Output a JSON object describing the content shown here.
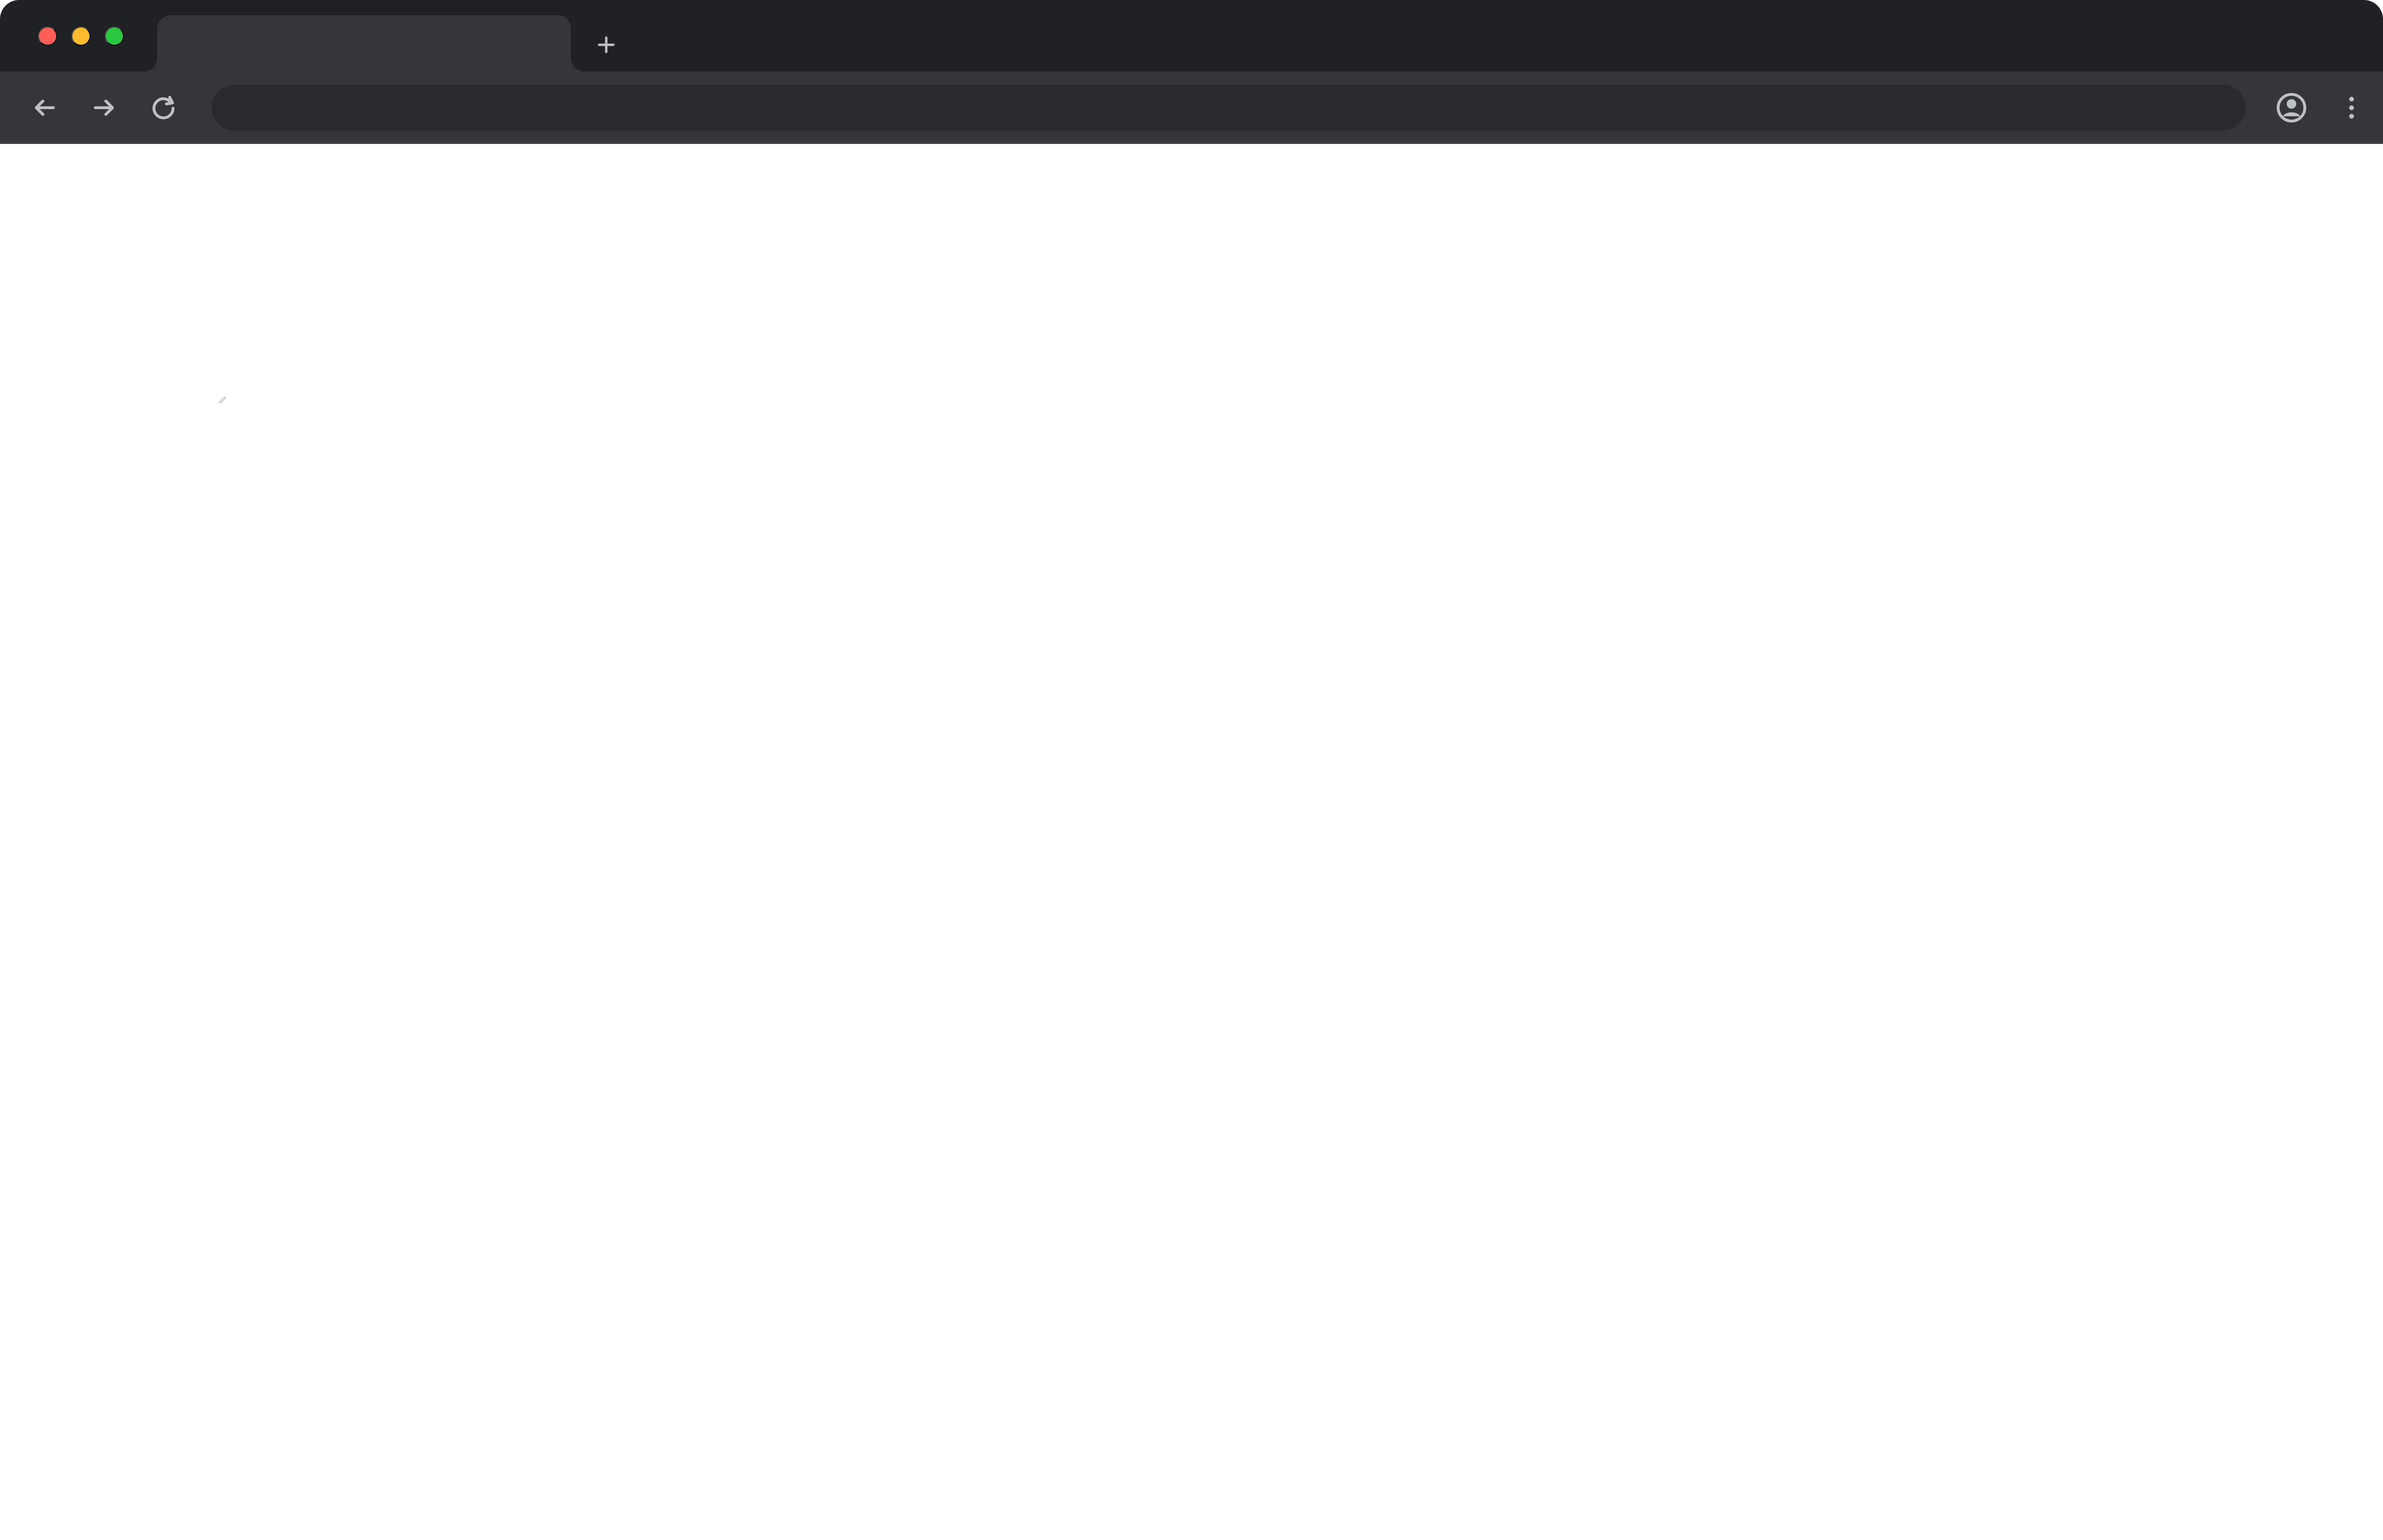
{
  "browser": {
    "tab": {
      "title": ""
    },
    "address_bar": {
      "value": "",
      "placeholder": ""
    },
    "content": {
      "visible_text": ""
    }
  },
  "icons": {
    "window_controls": [
      "close-icon",
      "minimize-icon",
      "maximize-icon"
    ],
    "new_tab": "plus-icon",
    "back": "arrow-left-icon",
    "forward": "arrow-right-icon",
    "reload": "reload-icon",
    "profile": "profile-icon",
    "menu": "vertical-dots-icon"
  },
  "colors": {
    "tab_strip": "#202124",
    "toolbar": "#35363a",
    "address_bar": "#292a2d",
    "icon": "#bdc1c6",
    "content_background": "#ffffff",
    "close": "#ff5f57",
    "minimize": "#febc2e",
    "maximize": "#28c840"
  }
}
